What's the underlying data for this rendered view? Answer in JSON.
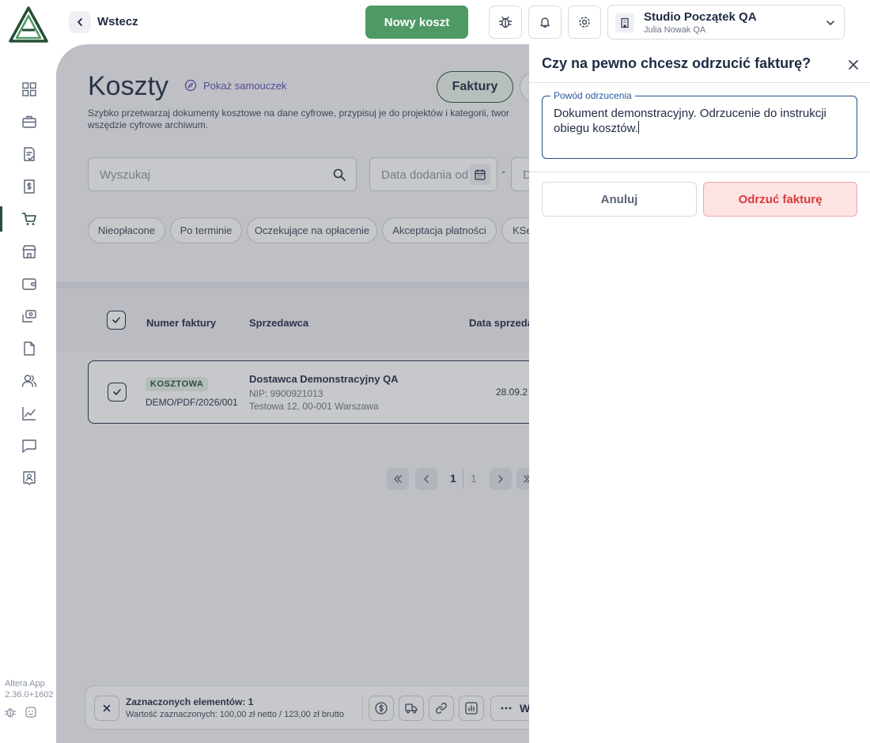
{
  "header": {
    "back_label": "Wstecz",
    "new_cost_label": "Nowy koszt",
    "company_name": "Studio Początek QA",
    "company_user": "Julia Nowak QA"
  },
  "sidebar": {
    "active_item": "costs",
    "items": [
      "grid-icon",
      "briefcase-icon",
      "document-check-icon",
      "invoice-dollar-icon",
      "cart-icon",
      "store-icon",
      "wallet-icon",
      "transfer-icon",
      "file-icon",
      "users-icon",
      "chart-icon",
      "chat-icon",
      "contact-icon"
    ],
    "version_app": "Altera App",
    "version_number": "2.36.0+1602"
  },
  "main": {
    "title": "Koszty",
    "tutorial_label": "Pokaż samouczek",
    "tabs": [
      {
        "label": "Faktury"
      }
    ],
    "description": "Szybko przetwarzaj dokumenty kosztowe na dane cyfrowe, przypisuj je do projektów i kategorii, twor wszędzie cyfrowe archiwum.",
    "search_placeholder": "Wyszukaj",
    "date_from_placeholder": "Data dodania od",
    "date_to_placeholder": "D",
    "date_separator": "-",
    "chips": [
      "Nieopłacone",
      "Po terminie",
      "Oczekujące na opłacenie",
      "Akceptacja płatności",
      "KSe"
    ],
    "table": {
      "columns": [
        "Numer faktury",
        "Sprzedawca",
        "Data sprzeda"
      ],
      "rows": [
        {
          "badge": "KOSZTOWA",
          "invoice_number": "DEMO/PDF/2026/001",
          "seller_name": "Dostawca Demonstracyjny QA",
          "seller_nip": "NIP: 9900921013",
          "seller_address": "Testowa 12, 00-001 Warszawa",
          "sale_date": "28.09.2"
        }
      ]
    },
    "pagination": {
      "current": "1",
      "total": "1"
    },
    "selection": {
      "title": "Zaznaczonych elementów: 1",
      "value": "Wartość zaznaczonych: 100,00 zł netto / 123,00 zł brutto",
      "more_label": "W"
    }
  },
  "drawer": {
    "title": "Czy na pewno chcesz odrzucić fakturę?",
    "reason_label": "Powód odrzucenia",
    "reason_value": "Dokument demonstracyjny. Odrzucenie do instrukcji obiegu kosztów.",
    "cancel_label": "Anuluj",
    "reject_label": "Odrzuć fakturę"
  },
  "colors": {
    "brand_green": "#4f9a64",
    "dark_green": "#264e37",
    "reject_red": "#d83b3b",
    "reject_bg": "#fde3e3",
    "focus_blue": "#264e86"
  }
}
